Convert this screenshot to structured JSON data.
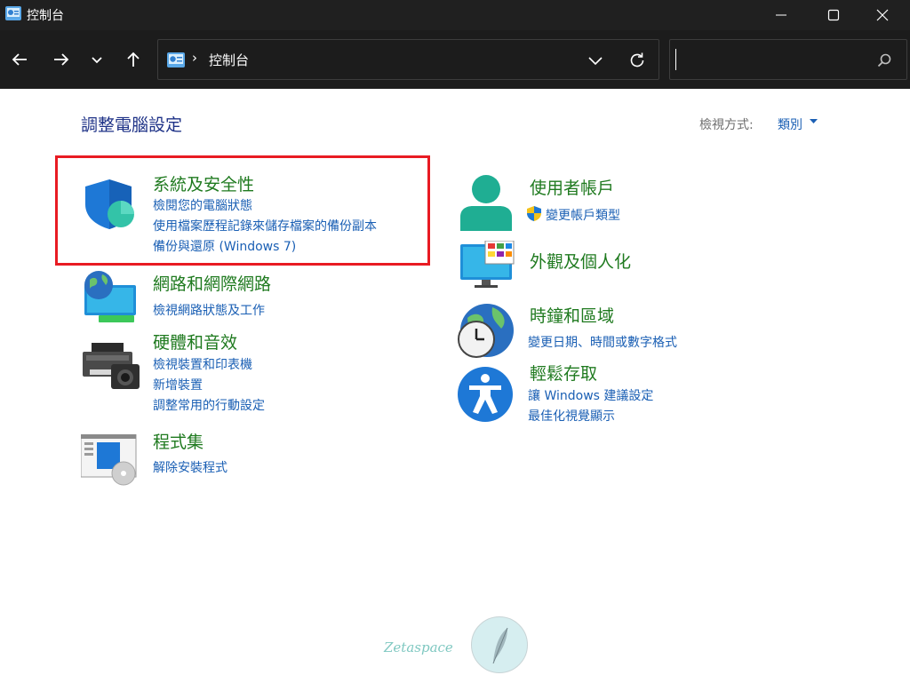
{
  "window": {
    "title": "控制台",
    "minimize_icon": "minimize-icon",
    "maximize_icon": "maximize-icon",
    "close_icon": "close-icon"
  },
  "nav": {
    "breadcrumb": {
      "separator": "›",
      "current": "控制台"
    },
    "search": {
      "value": "",
      "placeholder": ""
    }
  },
  "main": {
    "title": "調整電腦設定",
    "view_by_label": "檢視方式:",
    "view_by_value": "類別"
  },
  "categories": {
    "system_security": {
      "title": "系統及安全性",
      "links": [
        "檢閱您的電腦狀態",
        "使用檔案歷程記錄來儲存檔案的備份副本",
        "備份與還原 (Windows 7)"
      ]
    },
    "network": {
      "title": "網路和網際網路",
      "links": [
        "檢視網路狀態及工作"
      ]
    },
    "hardware": {
      "title": "硬體和音效",
      "links": [
        "檢視裝置和印表機",
        "新增裝置",
        "調整常用的行動設定"
      ]
    },
    "programs": {
      "title": "程式集",
      "links": [
        "解除安裝程式"
      ]
    },
    "user_accounts": {
      "title": "使用者帳戶",
      "links": [
        "變更帳戶類型"
      ]
    },
    "appearance": {
      "title": "外觀及個人化",
      "links": []
    },
    "clock_region": {
      "title": "時鐘和區域",
      "links": [
        "變更日期、時間或數字格式"
      ]
    },
    "ease_of_access": {
      "title": "輕鬆存取",
      "links": [
        "讓 Windows 建議設定",
        "最佳化視覺顯示"
      ]
    }
  },
  "watermark": {
    "text": "Zetaspace"
  },
  "colors": {
    "titlebar_bg": "#202020",
    "navbar_bg": "#1c1c1c",
    "category_title": "#1f7a1f",
    "link": "#1a5fb4",
    "page_title": "#1e3287",
    "highlight": "#e81b23"
  }
}
